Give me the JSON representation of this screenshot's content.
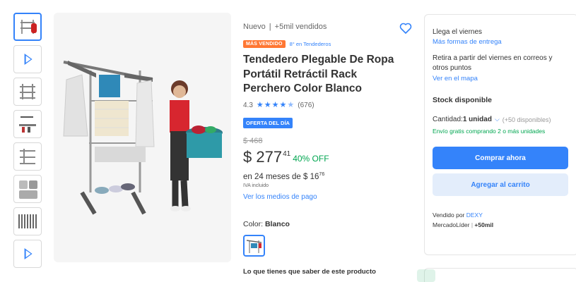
{
  "product": {
    "condition": "Nuevo",
    "separator": "|",
    "sold": "+5mil vendidos",
    "bestseller_badge": "MÁS VENDIDO",
    "rank_link": "8° en Tendederos",
    "title": "Tendedero Plegable De Ropa Portátil Retráctil Rack Perchero Color Blanco",
    "rating_value": "4.3",
    "rating_count": "(676)",
    "stars": 4.3,
    "deal_badge": "OFERTA DEL DÍA",
    "old_price": "$ 468",
    "price_symbol": "$ ",
    "price_integer": "277",
    "price_cents": "41",
    "discount": "40% OFF",
    "installments_prefix": "en 24 meses de $ 16",
    "installments_cents": "76",
    "iva": "IVA incluido",
    "payment_link": "Ver los medios de pago",
    "color_label": "Color: ",
    "color_value": "Blanco",
    "must_know": "Lo que tienes que saber de este producto"
  },
  "buybox": {
    "delivery": "Llega el viernes",
    "more_delivery": "Más formas de entrega",
    "pickup": "Retira a partir del viernes en correos y otros puntos",
    "map_link": "Ver en el mapa",
    "stock": "Stock disponible",
    "quantity_label": "Cantidad: ",
    "quantity_value": "1 unidad",
    "available": "(+50 disponibles)",
    "free_shipping": "Envío gratis comprando 2 o más unidades",
    "buy_now": "Comprar ahora",
    "add_cart": "Agregar al carrito",
    "sold_by": "Vendido por ",
    "seller_name": "DEXY",
    "seller_level": "MercadoLíder",
    "seller_sales": "+50mil"
  },
  "colors": {
    "accent": "#3483fa",
    "green": "#00a650",
    "orange": "#ff7733"
  }
}
